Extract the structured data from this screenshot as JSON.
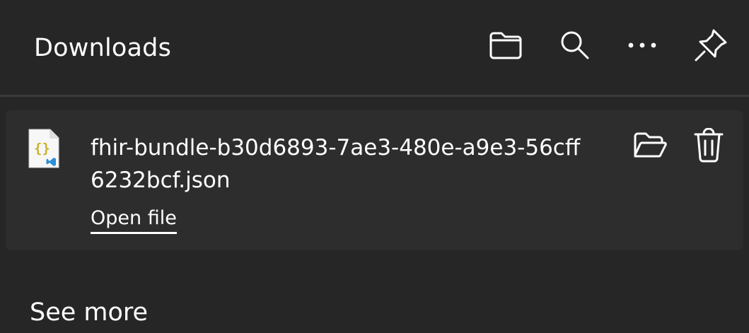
{
  "header": {
    "title": "Downloads",
    "actions": [
      {
        "name": "open-downloads-folder",
        "icon": "folder-icon"
      },
      {
        "name": "search-downloads",
        "icon": "search-icon"
      },
      {
        "name": "more-options",
        "icon": "more-icon"
      },
      {
        "name": "pin-panel",
        "icon": "pin-icon"
      }
    ]
  },
  "downloads": [
    {
      "file_name": "fhir-bundle-b30d6893-7ae3-480e-a9e3-56cff6232bcf.json",
      "file_icon": "json-file-icon",
      "action_label": "Open file",
      "buttons": [
        {
          "name": "show-in-folder",
          "icon": "folder-open-icon"
        },
        {
          "name": "delete",
          "icon": "trash-icon"
        }
      ]
    }
  ],
  "footer": {
    "see_more_label": "See more"
  },
  "colors": {
    "background": "#262626",
    "card": "#2d2d2d",
    "divider": "#3b3b3b",
    "text": "#ffffff",
    "json_brace": "#c9b22a",
    "vscode_badge": "#2b8fd6"
  }
}
